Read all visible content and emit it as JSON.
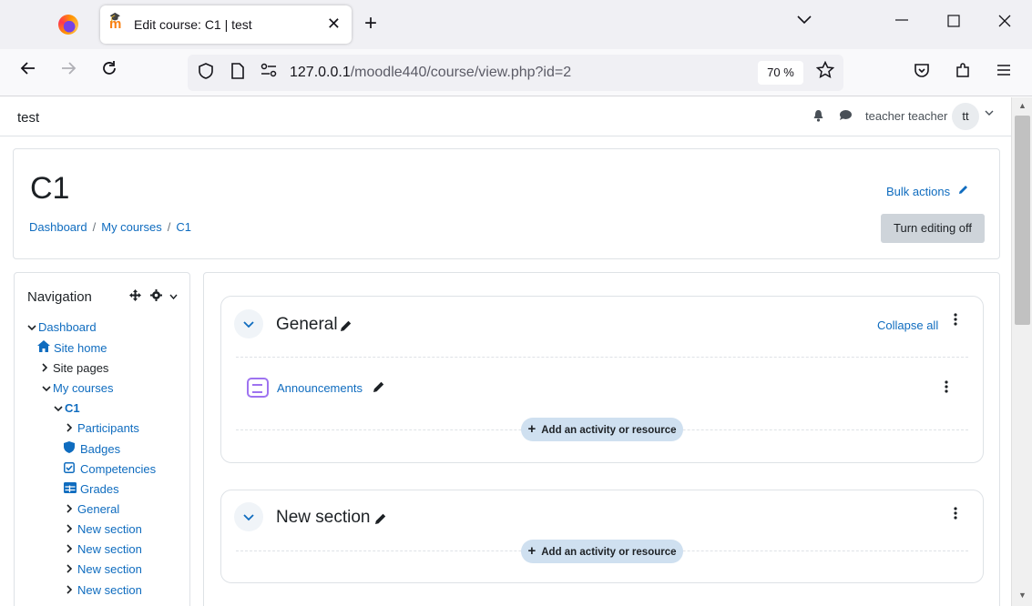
{
  "browser": {
    "tab_title": "Edit course: C1 | test",
    "tab_close": "✕",
    "new_tab": "+",
    "tab_list": "⌄",
    "url_host": "127.0.0.1",
    "url_path": "/moodle440/course/view.php?id=2",
    "zoom": "70 %",
    "window_controls": {
      "minimize": "—",
      "maximize": "☐",
      "close": "✕"
    }
  },
  "topbar": {
    "site_name": "test",
    "user_name": "teacher teacher",
    "avatar_initials": "tt"
  },
  "header": {
    "course_title": "C1",
    "breadcrumb": [
      "Dashboard",
      "My courses",
      "C1"
    ],
    "bulk_actions": "Bulk actions",
    "edit_toggle": "Turn editing off"
  },
  "navigation": {
    "title": "Navigation",
    "items": [
      {
        "label": "Dashboard",
        "caret": "⌄",
        "icon": ""
      },
      {
        "label": "Site home",
        "caret": "",
        "icon": "home-icon"
      },
      {
        "label": "Site pages",
        "caret": "›",
        "icon": ""
      },
      {
        "label": "My courses",
        "caret": "⌄",
        "icon": ""
      },
      {
        "label": "C1",
        "caret": "⌄",
        "icon": ""
      },
      {
        "label": "Participants",
        "caret": "›",
        "icon": ""
      },
      {
        "label": "Badges",
        "caret": "",
        "icon": "shield-icon"
      },
      {
        "label": "Competencies",
        "caret": "",
        "icon": "checkbox-icon"
      },
      {
        "label": "Grades",
        "caret": "",
        "icon": "table-icon"
      },
      {
        "label": "General",
        "caret": "›",
        "icon": ""
      },
      {
        "label": "New section",
        "caret": "›",
        "icon": ""
      },
      {
        "label": "New section",
        "caret": "›",
        "icon": ""
      },
      {
        "label": "New section",
        "caret": "›",
        "icon": ""
      },
      {
        "label": "New section",
        "caret": "›",
        "icon": ""
      }
    ]
  },
  "sections": [
    {
      "title": "General",
      "collapse_all": "Collapse all",
      "activities": [
        {
          "name": "Announcements",
          "icon": "forum-icon"
        }
      ],
      "add_label": "Add an activity or resource"
    },
    {
      "title": "New section",
      "activities": [],
      "add_label": "Add an activity or resource"
    }
  ],
  "colors": {
    "link": "#0f6cbf",
    "edit_button": "#ced4da",
    "add_button": "#cfe0f0",
    "forum_icon": "#9e73f0"
  }
}
